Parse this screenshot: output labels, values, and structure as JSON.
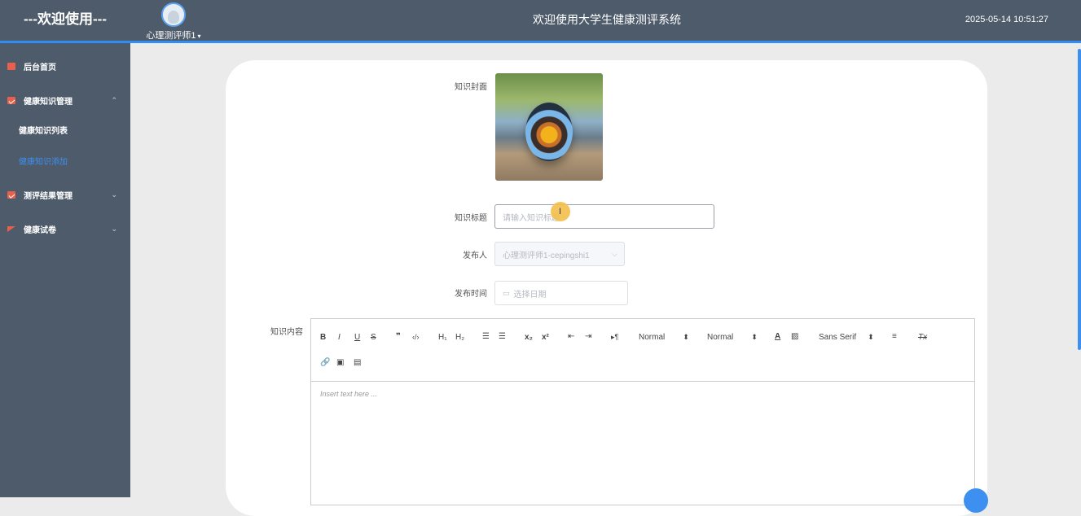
{
  "header": {
    "welcome": "---欢迎使用---",
    "user": "心理测评师1",
    "user_caret": "▾",
    "title": "欢迎使用大学生健康测评系统",
    "datetime": "2025-05-14 10:51:27"
  },
  "sidebar": {
    "items": [
      {
        "label": "后台首页",
        "icon": "monitor-icon"
      },
      {
        "label": "健康知识管理",
        "icon": "chart-icon",
        "arrow": "⌃"
      },
      {
        "label": "测评结果管理",
        "icon": "chart-icon",
        "arrow": "⌄"
      },
      {
        "label": "健康试卷",
        "icon": "flag-icon",
        "arrow": "⌄"
      }
    ],
    "subitems": [
      {
        "label": "健康知识列表"
      },
      {
        "label": "健康知识添加",
        "active": true
      }
    ]
  },
  "form": {
    "cover_label": "知识封面",
    "title_label": "知识标题",
    "title_placeholder": "请输入知识标题",
    "publisher_label": "发布人",
    "publisher_value": "心理测评师1-cepingshi1",
    "publish_time_label": "发布时间",
    "publish_time_placeholder": "选择日期",
    "content_label": "知识内容"
  },
  "editor": {
    "toolbar": {
      "bold": "B",
      "italic": "I",
      "underline": "U",
      "strike": "S",
      "blockquote": "❞",
      "code": "‹/›",
      "h1": "H₁",
      "h2": "H₂",
      "ordered_list": "☰",
      "bullet_list": "☰",
      "subscript": "x₂",
      "superscript": "x²",
      "outdent": "⇤",
      "indent": "⇥",
      "direction": "▸¶",
      "size_select": "Normal",
      "header_select": "Normal",
      "color": "A",
      "background": "▨",
      "font_select": "Sans Serif",
      "align": "≡",
      "clean": "Tx",
      "link": "🔗",
      "image": "▣",
      "video": "▤",
      "select_caret": "⬍"
    },
    "placeholder": "Insert text here ..."
  },
  "colors": {
    "header_bg": "#4e5b6b",
    "accent": "#2f8df5",
    "active_menu": "#3d8ff0",
    "icon_red": "#e8604c"
  }
}
